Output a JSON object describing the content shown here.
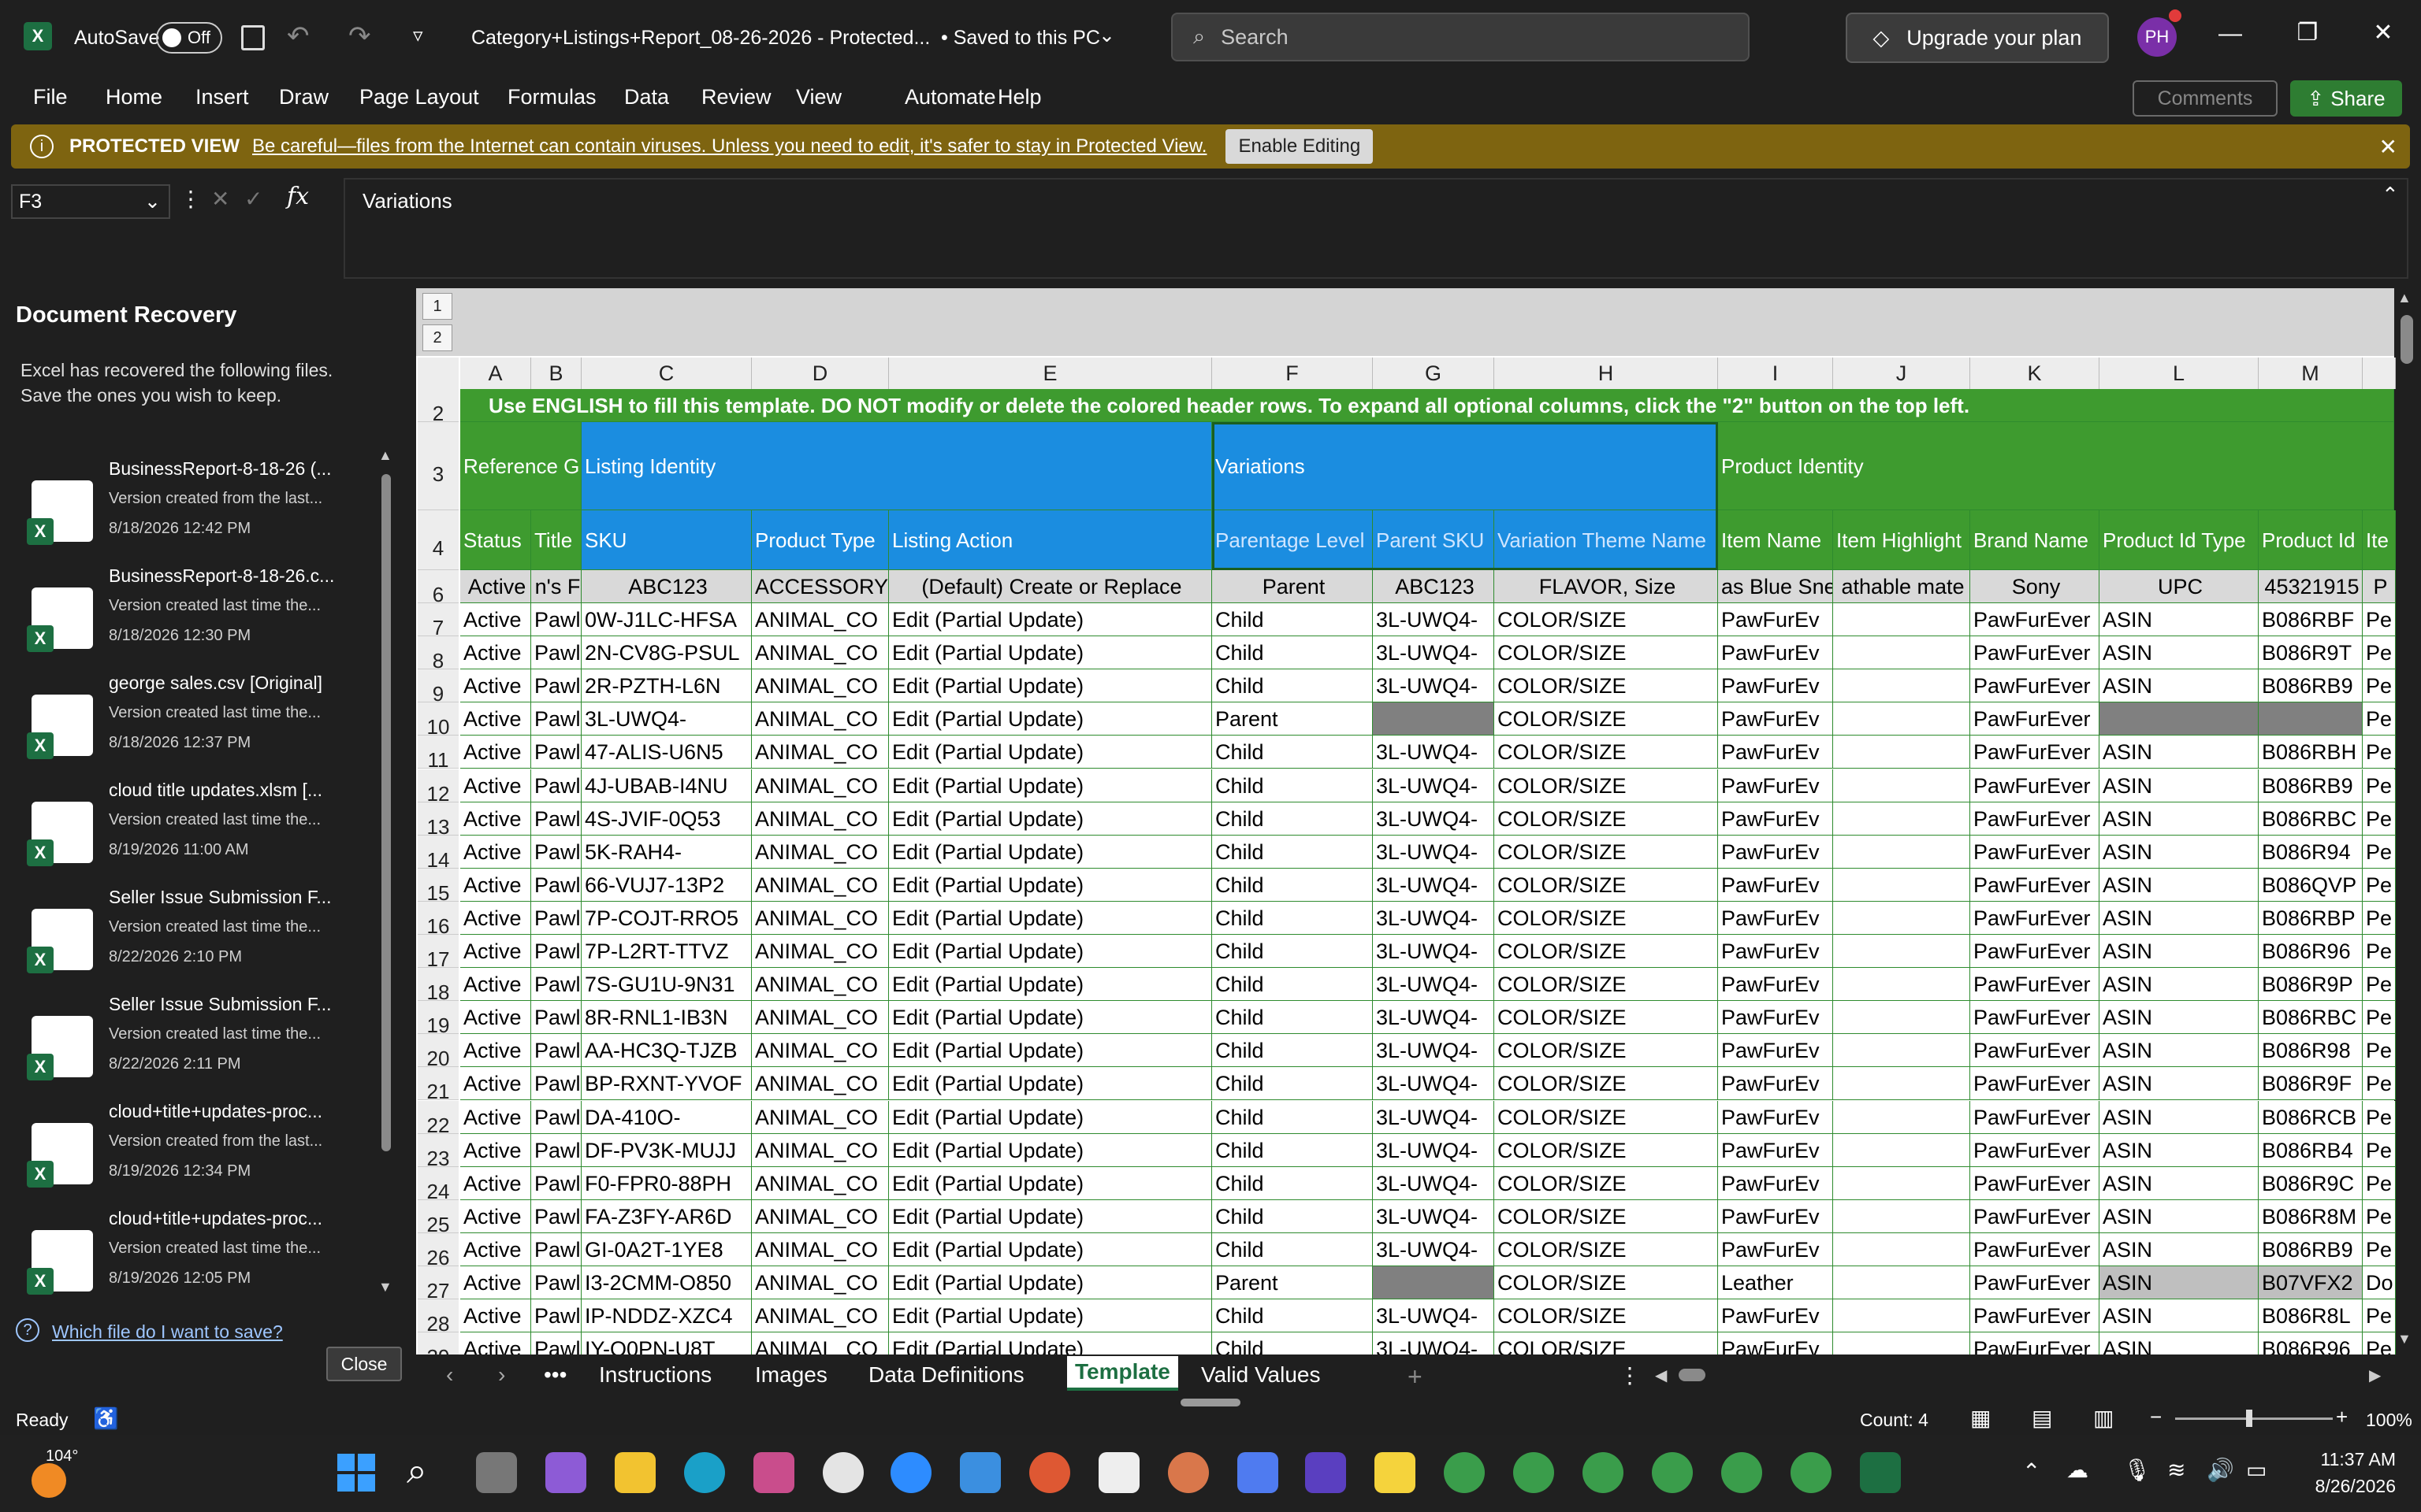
{
  "titlebar": {
    "autosave_label": "AutoSave",
    "autosave_state": "Off",
    "file_title": "Category+Listings+Report_08-26-2026  -  Protected...",
    "save_status": "• Saved to this PC",
    "search_placeholder": "Search",
    "upgrade_label": "Upgrade your plan",
    "avatar_initials": "PH"
  },
  "menu": {
    "items": [
      "File",
      "Home",
      "Insert",
      "Draw",
      "Page Layout",
      "Formulas",
      "Data",
      "Review",
      "View",
      "Automate",
      "Help"
    ],
    "comments": "Comments",
    "share": "Share"
  },
  "protected_view": {
    "title": "PROTECTED VIEW",
    "message": "Be careful—files from the Internet can contain viruses. Unless you need to edit, it's safer to stay in Protected View.",
    "button": "Enable Editing"
  },
  "formula_bar": {
    "cell_ref": "F3",
    "content": "Variations"
  },
  "recovery": {
    "title": "Document Recovery",
    "description_line1": "Excel has recovered the following files.",
    "description_line2": "Save the ones you wish to keep.",
    "files": [
      {
        "name": "BusinessReport-8-18-26 (...",
        "sub": "Version created from the last...",
        "date": "8/18/2026 12:42 PM",
        "icon": "excel-icon"
      },
      {
        "name": "BusinessReport-8-18-26.c...",
        "sub": "Version created last time the...",
        "date": "8/18/2026 12:30 PM",
        "icon": "csv-icon"
      },
      {
        "name": "george sales.csv  [Original]",
        "sub": "Version created last time the...",
        "date": "8/18/2026 12:37 PM",
        "icon": "csv-icon"
      },
      {
        "name": "cloud title updates.xlsm  [...",
        "sub": "Version created last time the...",
        "date": "8/19/2026 11:00 AM",
        "icon": "excel-macro-icon"
      },
      {
        "name": "Seller Issue Submission F...",
        "sub": "Version created last time the...",
        "date": "8/22/2026 2:10 PM",
        "icon": "excel-macro-icon"
      },
      {
        "name": "Seller Issue Submission F...",
        "sub": "Version created last time the...",
        "date": "8/22/2026 2:11 PM",
        "icon": "excel-macro-icon"
      },
      {
        "name": "cloud+title+updates-proc...",
        "sub": "Version created from the last...",
        "date": "8/19/2026 12:34 PM",
        "icon": "excel-icon"
      },
      {
        "name": "cloud+title+updates-proc...",
        "sub": "Version created last time the...",
        "date": "8/19/2026 12:05 PM",
        "icon": "excel-macro-icon"
      }
    ],
    "help_link": "Which file do I want to save?",
    "close_button": "Close"
  },
  "sheet": {
    "outline_levels": [
      "1",
      "2"
    ],
    "columns": [
      "A",
      "B",
      "C",
      "D",
      "E",
      "F",
      "G",
      "H",
      "I",
      "J",
      "K",
      "L",
      "M",
      ""
    ],
    "row2_text": "Use ENGLISH to fill this template. DO NOT modify or delete the colored header rows. To expand all optional columns, click the \"2\" button on the top left.",
    "row3_groups": [
      "Reference Gr",
      "Listing Identity",
      "Variations",
      "Product Identity"
    ],
    "row4_headers": [
      "Status",
      "Title",
      "SKU",
      "Product Type",
      "Listing Action",
      "Parentage Level",
      "Parent SKU",
      "Variation Theme Name",
      "Item Name",
      "Item Highlight",
      "Brand Name",
      "Product Id Type",
      "Product Id",
      "Ite"
    ],
    "row6_examples": [
      "Active",
      "n's F",
      "ABC123",
      "ACCESSORY",
      "(Default) Create or Replace",
      "Parent",
      "ABC123",
      "FLAVOR, Size",
      "as Blue Sne",
      "athable mate",
      "Sony",
      "UPC",
      "45321915",
      "P"
    ],
    "rows": [
      {
        "n": "7",
        "c": [
          "Active",
          "Pawl",
          "0W-J1LC-HFSA",
          "ANIMAL_CO",
          "Edit (Partial Update)",
          "Child",
          "3L-UWQ4-",
          "COLOR/SIZE",
          "PawFurEv",
          "",
          "PawFurEver",
          "ASIN",
          "B086RBF",
          "Pe"
        ]
      },
      {
        "n": "8",
        "c": [
          "Active",
          "Pawl",
          "2N-CV8G-PSUL",
          "ANIMAL_CO",
          "Edit (Partial Update)",
          "Child",
          "3L-UWQ4-",
          "COLOR/SIZE",
          "PawFurEv",
          "",
          "PawFurEver",
          "ASIN",
          "B086R9T",
          "Pe"
        ]
      },
      {
        "n": "9",
        "c": [
          "Active",
          "Pawl",
          "2R-PZTH-L6N",
          "ANIMAL_CO",
          "Edit (Partial Update)",
          "Child",
          "3L-UWQ4-",
          "COLOR/SIZE",
          "PawFurEv",
          "",
          "PawFurEver",
          "ASIN",
          "B086RB9",
          "Pe"
        ]
      },
      {
        "n": "10",
        "c": [
          "Active",
          "Pawl",
          "3L-UWQ4-",
          "ANIMAL_CO",
          "Edit (Partial Update)",
          "Parent",
          "",
          "COLOR/SIZE",
          "PawFurEv",
          "",
          "PawFurEver",
          "",
          "",
          "Pe"
        ]
      },
      {
        "n": "11",
        "c": [
          "Active",
          "Pawl",
          "47-ALIS-U6N5",
          "ANIMAL_CO",
          "Edit (Partial Update)",
          "Child",
          "3L-UWQ4-",
          "COLOR/SIZE",
          "PawFurEv",
          "",
          "PawFurEver",
          "ASIN",
          "B086RBH",
          "Pe"
        ]
      },
      {
        "n": "12",
        "c": [
          "Active",
          "Pawl",
          "4J-UBAB-I4NU",
          "ANIMAL_CO",
          "Edit (Partial Update)",
          "Child",
          "3L-UWQ4-",
          "COLOR/SIZE",
          "PawFurEv",
          "",
          "PawFurEver",
          "ASIN",
          "B086RB9",
          "Pe"
        ]
      },
      {
        "n": "13",
        "c": [
          "Active",
          "Pawl",
          "4S-JVIF-0Q53",
          "ANIMAL_CO",
          "Edit (Partial Update)",
          "Child",
          "3L-UWQ4-",
          "COLOR/SIZE",
          "PawFurEv",
          "",
          "PawFurEver",
          "ASIN",
          "B086RBC",
          "Pe"
        ]
      },
      {
        "n": "14",
        "c": [
          "Active",
          "Pawl",
          "5K-RAH4-",
          "ANIMAL_CO",
          "Edit (Partial Update)",
          "Child",
          "3L-UWQ4-",
          "COLOR/SIZE",
          "PawFurEv",
          "",
          "PawFurEver",
          "ASIN",
          "B086R94",
          "Pe"
        ]
      },
      {
        "n": "15",
        "c": [
          "Active",
          "Pawl",
          "66-VUJ7-13P2",
          "ANIMAL_CO",
          "Edit (Partial Update)",
          "Child",
          "3L-UWQ4-",
          "COLOR/SIZE",
          "PawFurEv",
          "",
          "PawFurEver",
          "ASIN",
          "B086QVP",
          "Pe"
        ]
      },
      {
        "n": "16",
        "c": [
          "Active",
          "Pawl",
          "7P-COJT-RRO5",
          "ANIMAL_CO",
          "Edit (Partial Update)",
          "Child",
          "3L-UWQ4-",
          "COLOR/SIZE",
          "PawFurEv",
          "",
          "PawFurEver",
          "ASIN",
          "B086RBP",
          "Pe"
        ]
      },
      {
        "n": "17",
        "c": [
          "Active",
          "Pawl",
          "7P-L2RT-TTVZ",
          "ANIMAL_CO",
          "Edit (Partial Update)",
          "Child",
          "3L-UWQ4-",
          "COLOR/SIZE",
          "PawFurEv",
          "",
          "PawFurEver",
          "ASIN",
          "B086R96",
          "Pe"
        ]
      },
      {
        "n": "18",
        "c": [
          "Active",
          "Pawl",
          "7S-GU1U-9N31",
          "ANIMAL_CO",
          "Edit (Partial Update)",
          "Child",
          "3L-UWQ4-",
          "COLOR/SIZE",
          "PawFurEv",
          "",
          "PawFurEver",
          "ASIN",
          "B086R9P",
          "Pe"
        ]
      },
      {
        "n": "19",
        "c": [
          "Active",
          "Pawl",
          "8R-RNL1-IB3N",
          "ANIMAL_CO",
          "Edit (Partial Update)",
          "Child",
          "3L-UWQ4-",
          "COLOR/SIZE",
          "PawFurEv",
          "",
          "PawFurEver",
          "ASIN",
          "B086RBC",
          "Pe"
        ]
      },
      {
        "n": "20",
        "c": [
          "Active",
          "Pawl",
          "AA-HC3Q-TJZB",
          "ANIMAL_CO",
          "Edit (Partial Update)",
          "Child",
          "3L-UWQ4-",
          "COLOR/SIZE",
          "PawFurEv",
          "",
          "PawFurEver",
          "ASIN",
          "B086R98",
          "Pe"
        ]
      },
      {
        "n": "21",
        "c": [
          "Active",
          "Pawl",
          "BP-RXNT-YVOF",
          "ANIMAL_CO",
          "Edit (Partial Update)",
          "Child",
          "3L-UWQ4-",
          "COLOR/SIZE",
          "PawFurEv",
          "",
          "PawFurEver",
          "ASIN",
          "B086R9F",
          "Pe"
        ]
      },
      {
        "n": "22",
        "c": [
          "Active",
          "Pawl",
          "DA-410O-",
          "ANIMAL_CO",
          "Edit (Partial Update)",
          "Child",
          "3L-UWQ4-",
          "COLOR/SIZE",
          "PawFurEv",
          "",
          "PawFurEver",
          "ASIN",
          "B086RCB",
          "Pe"
        ]
      },
      {
        "n": "23",
        "c": [
          "Active",
          "Pawl",
          "DF-PV3K-MUJJ",
          "ANIMAL_CO",
          "Edit (Partial Update)",
          "Child",
          "3L-UWQ4-",
          "COLOR/SIZE",
          "PawFurEv",
          "",
          "PawFurEver",
          "ASIN",
          "B086RB4",
          "Pe"
        ]
      },
      {
        "n": "24",
        "c": [
          "Active",
          "Pawl",
          "F0-FPR0-88PH",
          "ANIMAL_CO",
          "Edit (Partial Update)",
          "Child",
          "3L-UWQ4-",
          "COLOR/SIZE",
          "PawFurEv",
          "",
          "PawFurEver",
          "ASIN",
          "B086R9C",
          "Pe"
        ]
      },
      {
        "n": "25",
        "c": [
          "Active",
          "Pawl",
          "FA-Z3FY-AR6D",
          "ANIMAL_CO",
          "Edit (Partial Update)",
          "Child",
          "3L-UWQ4-",
          "COLOR/SIZE",
          "PawFurEv",
          "",
          "PawFurEver",
          "ASIN",
          "B086R8M",
          "Pe"
        ]
      },
      {
        "n": "26",
        "c": [
          "Active",
          "Pawl",
          "GI-0A2T-1YE8",
          "ANIMAL_CO",
          "Edit (Partial Update)",
          "Child",
          "3L-UWQ4-",
          "COLOR/SIZE",
          "PawFurEv",
          "",
          "PawFurEver",
          "ASIN",
          "B086RB9",
          "Pe"
        ]
      },
      {
        "n": "27",
        "c": [
          "Active",
          "Pawl",
          "I3-2CMM-O850",
          "ANIMAL_CO",
          "Edit (Partial Update)",
          "Parent",
          "",
          "COLOR/SIZE",
          "Leather",
          "",
          "PawFurEver",
          "ASIN",
          "B07VFX2",
          "Do"
        ]
      },
      {
        "n": "28",
        "c": [
          "Active",
          "Pawl",
          "IP-NDDZ-XZC4",
          "ANIMAL_CO",
          "Edit (Partial Update)",
          "Child",
          "3L-UWQ4-",
          "COLOR/SIZE",
          "PawFurEv",
          "",
          "PawFurEver",
          "ASIN",
          "B086R8L",
          "Pe"
        ]
      },
      {
        "n": "29",
        "c": [
          "Active",
          "Pawl",
          "IY-Q0PN-U8T",
          "ANIMAL_CO",
          "Edit (Partial Update)",
          "Child",
          "3L-UWQ4-",
          "COLOR/SIZE",
          "PawFurEv",
          "",
          "PawFurEver",
          "ASIN",
          "B086R96",
          "Pe"
        ]
      }
    ],
    "tabs": [
      "Instructions",
      "Images",
      "Data Definitions",
      "Template",
      "Valid Values"
    ],
    "active_tab": "Template"
  },
  "status_bar": {
    "ready": "Ready",
    "count": "Count: 4",
    "zoom": "100%"
  },
  "taskbar": {
    "weather": "104°",
    "time": "11:37 AM",
    "date": "8/26/2026"
  },
  "colors": {
    "group_green": "#3e9b2f",
    "group_blue": "#1b8de0",
    "pv_yellow": "#7e6410",
    "gray_fill": "#808080"
  }
}
